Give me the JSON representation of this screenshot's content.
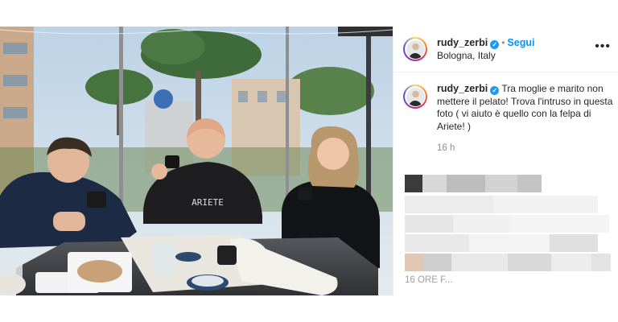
{
  "post": {
    "username": "rudy_zerbi",
    "verified_mark": "✓",
    "separator": "•",
    "follow_label": "Segui",
    "location": "Bologna, Italy",
    "more_icon": "•••",
    "caption_text": "Tra moglie e marito non mettere il pelato! Trova l'intruso in questa foto ( vi aiuto è quello con la felpa di Ariete! )",
    "time_ago": "16 h",
    "comment_time": "16 ORE F..."
  },
  "photo": {
    "hoodie_print": "ARIETE"
  },
  "colors": {
    "follow_blue": "#0095f6",
    "verified_blue": "#1d9bf0",
    "muted_gray": "#8e8e8e"
  }
}
